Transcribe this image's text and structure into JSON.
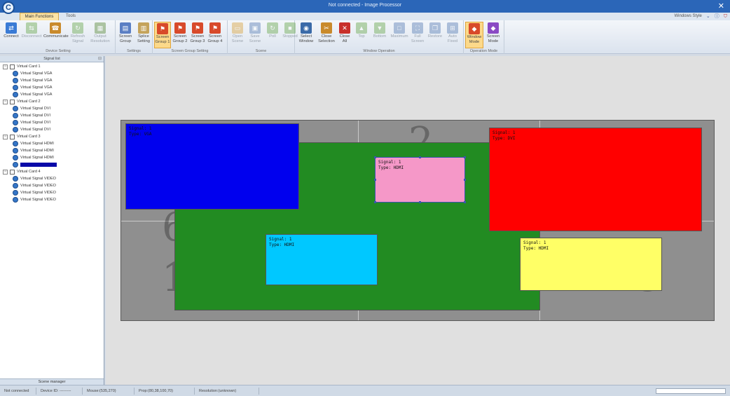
{
  "window": {
    "title": "Not connected - Image Processor",
    "logo": "C",
    "close_glyph": "✕"
  },
  "tabs": [
    {
      "label": "Main Functions",
      "active": true
    },
    {
      "label": "Tools",
      "active": false
    }
  ],
  "user": {
    "label": "Windows Style",
    "icons": [
      "chevron-icon",
      "info-icon",
      "shield-icon"
    ]
  },
  "ribbon": {
    "groups": [
      {
        "label": "Device Setting",
        "buttons": [
          {
            "label": "Connect",
            "icon": "connect-icon",
            "color": "#3a7bd5",
            "glyph": "⇄",
            "enabled": true
          },
          {
            "label": "Disconnect",
            "icon": "disconnect-icon",
            "color": "#6aa84f",
            "glyph": "⇆",
            "enabled": false
          },
          {
            "label": "Communicate",
            "icon": "communicate-icon",
            "color": "#c98a2b",
            "glyph": "☎",
            "enabled": true
          },
          {
            "label": "Refresh\nSignal",
            "icon": "refresh-icon",
            "color": "#6aa84f",
            "glyph": "↻",
            "enabled": false
          },
          {
            "label": "Output\nResolution",
            "icon": "resolution-icon",
            "color": "#5a8a3a",
            "glyph": "▦",
            "enabled": false
          }
        ]
      },
      {
        "label": "Settings",
        "buttons": [
          {
            "label": "Screen\nGroup",
            "icon": "screen-group-icon",
            "color": "#5b7fc4",
            "glyph": "▤",
            "enabled": true
          },
          {
            "label": "Splice\nSetting",
            "icon": "splice-icon",
            "color": "#c4a35b",
            "glyph": "▥",
            "enabled": true
          }
        ]
      },
      {
        "label": "Screen Group Setting",
        "buttons": [
          {
            "label": "Screen\nGroup 1",
            "icon": "flag-icon",
            "color": "#d84a2a",
            "glyph": "⚑",
            "enabled": true,
            "active": true
          },
          {
            "label": "Screen\nGroup 2",
            "icon": "flag-icon",
            "color": "#d84a2a",
            "glyph": "⚑",
            "enabled": true
          },
          {
            "label": "Screen\nGroup 3",
            "icon": "flag-icon",
            "color": "#d84a2a",
            "glyph": "⚑",
            "enabled": true
          },
          {
            "label": "Screen\nGroup 4",
            "icon": "flag-icon",
            "color": "#d84a2a",
            "glyph": "⚑",
            "enabled": true
          }
        ]
      },
      {
        "label": "Scene",
        "buttons": [
          {
            "label": "Open\nScene",
            "icon": "folder-icon",
            "color": "#d9a441",
            "glyph": "▭",
            "enabled": false
          },
          {
            "label": "Save\nScene",
            "icon": "save-icon",
            "color": "#5a7fb5",
            "glyph": "▣",
            "enabled": false
          },
          {
            "label": "Poll",
            "icon": "poll-icon",
            "color": "#6aa84f",
            "glyph": "↻",
            "enabled": false
          },
          {
            "label": "Stopped",
            "icon": "stop-icon",
            "color": "#6aa84f",
            "glyph": "■",
            "enabled": false
          }
        ]
      },
      {
        "label": "Window Operation",
        "buttons": [
          {
            "label": "Select\nWindow",
            "icon": "select-window-icon",
            "color": "#3a6aa8",
            "glyph": "◉",
            "enabled": true
          },
          {
            "label": "Close\nSelection",
            "icon": "close-selection-icon",
            "color": "#c98a2b",
            "glyph": "✂",
            "enabled": true
          },
          {
            "label": "Close\nAll",
            "icon": "close-all-icon",
            "color": "#c8302a",
            "glyph": "✕",
            "enabled": true
          },
          {
            "label": "Top",
            "icon": "arrow-up-icon",
            "color": "#6aa84f",
            "glyph": "▲",
            "enabled": false
          },
          {
            "label": "Bottom",
            "icon": "arrow-down-icon",
            "color": "#6aa84f",
            "glyph": "▼",
            "enabled": false
          },
          {
            "label": "Maximum",
            "icon": "maximize-icon",
            "color": "#5a7fb5",
            "glyph": "□",
            "enabled": false
          },
          {
            "label": "Full\nScreen",
            "icon": "fullscreen-icon",
            "color": "#5a7fb5",
            "glyph": "⛶",
            "enabled": false
          },
          {
            "label": "Restore",
            "icon": "restore-icon",
            "color": "#5a7fb5",
            "glyph": "❐",
            "enabled": false
          },
          {
            "label": "Auto\nFixed",
            "icon": "auto-fixed-icon",
            "color": "#5a7fb5",
            "glyph": "⊞",
            "enabled": false
          }
        ]
      },
      {
        "label": "Operation Mode",
        "buttons": [
          {
            "label": "Window\nMode",
            "icon": "window-mode-icon",
            "color": "#d84a2a",
            "glyph": "◆",
            "enabled": true,
            "active": true
          },
          {
            "label": "Screen\nMode",
            "icon": "screen-mode-icon",
            "color": "#8a4ac4",
            "glyph": "◆",
            "enabled": true
          }
        ]
      }
    ]
  },
  "signal_panel": {
    "title": "Signal list",
    "pin_glyph": "⊟",
    "toggle_glyph": "−",
    "footer": "Scene manager",
    "cards": [
      {
        "label": "Virtual Card 1",
        "signals": [
          "Virtual Signal VGA",
          "Virtual Signal VGA",
          "Virtual Signal VGA",
          "Virtual Signal VGA"
        ]
      },
      {
        "label": "Virtual Card 2",
        "signals": [
          "Virtual Signal DVI",
          "Virtual Signal DVI",
          "Virtual Signal DVI",
          "Virtual Signal DVI"
        ]
      },
      {
        "label": "Virtual Card 3",
        "signals": [
          "Virtual Signal HDMI",
          "Virtual Signal HDMI",
          "Virtual Signal HDMI",
          "Virtual Signal HDMI"
        ]
      },
      {
        "label": "Virtual Card 4",
        "signals": [
          "Virtual Signal VIDEO",
          "Virtual Signal VIDEO",
          "Virtual Signal VIDEO",
          "Virtual Signal VIDEO"
        ]
      }
    ]
  },
  "wall": {
    "screen_numbers": [
      "2",
      "6",
      "1",
      "5"
    ],
    "windows": [
      {
        "name": "window-blue",
        "color": "#0000ee",
        "line1": "Signal: 1",
        "line2": "Type: VGA"
      },
      {
        "name": "window-green",
        "color": "#228b22",
        "line1": "",
        "line2": ""
      },
      {
        "name": "window-pink",
        "color": "#f598c8",
        "line1": "Signal: 1",
        "line2": "Type: HDMI"
      },
      {
        "name": "window-red",
        "color": "#ff0000",
        "line1": "Signal: 1",
        "line2": "Type: DVI"
      },
      {
        "name": "window-cyan",
        "color": "#00c8ff",
        "line1": "Signal: 1",
        "line2": "Type: HDMI"
      },
      {
        "name": "window-yellow",
        "color": "#ffff66",
        "line1": "Signal: 1",
        "line2": "Type: HDMI"
      }
    ]
  },
  "status_bar": {
    "cells": [
      "Not connected",
      "Device ID: ---------",
      "Mouse:(535,270)",
      "Prop:(80,38,100,70)",
      "Resolution:(unknown)"
    ]
  }
}
